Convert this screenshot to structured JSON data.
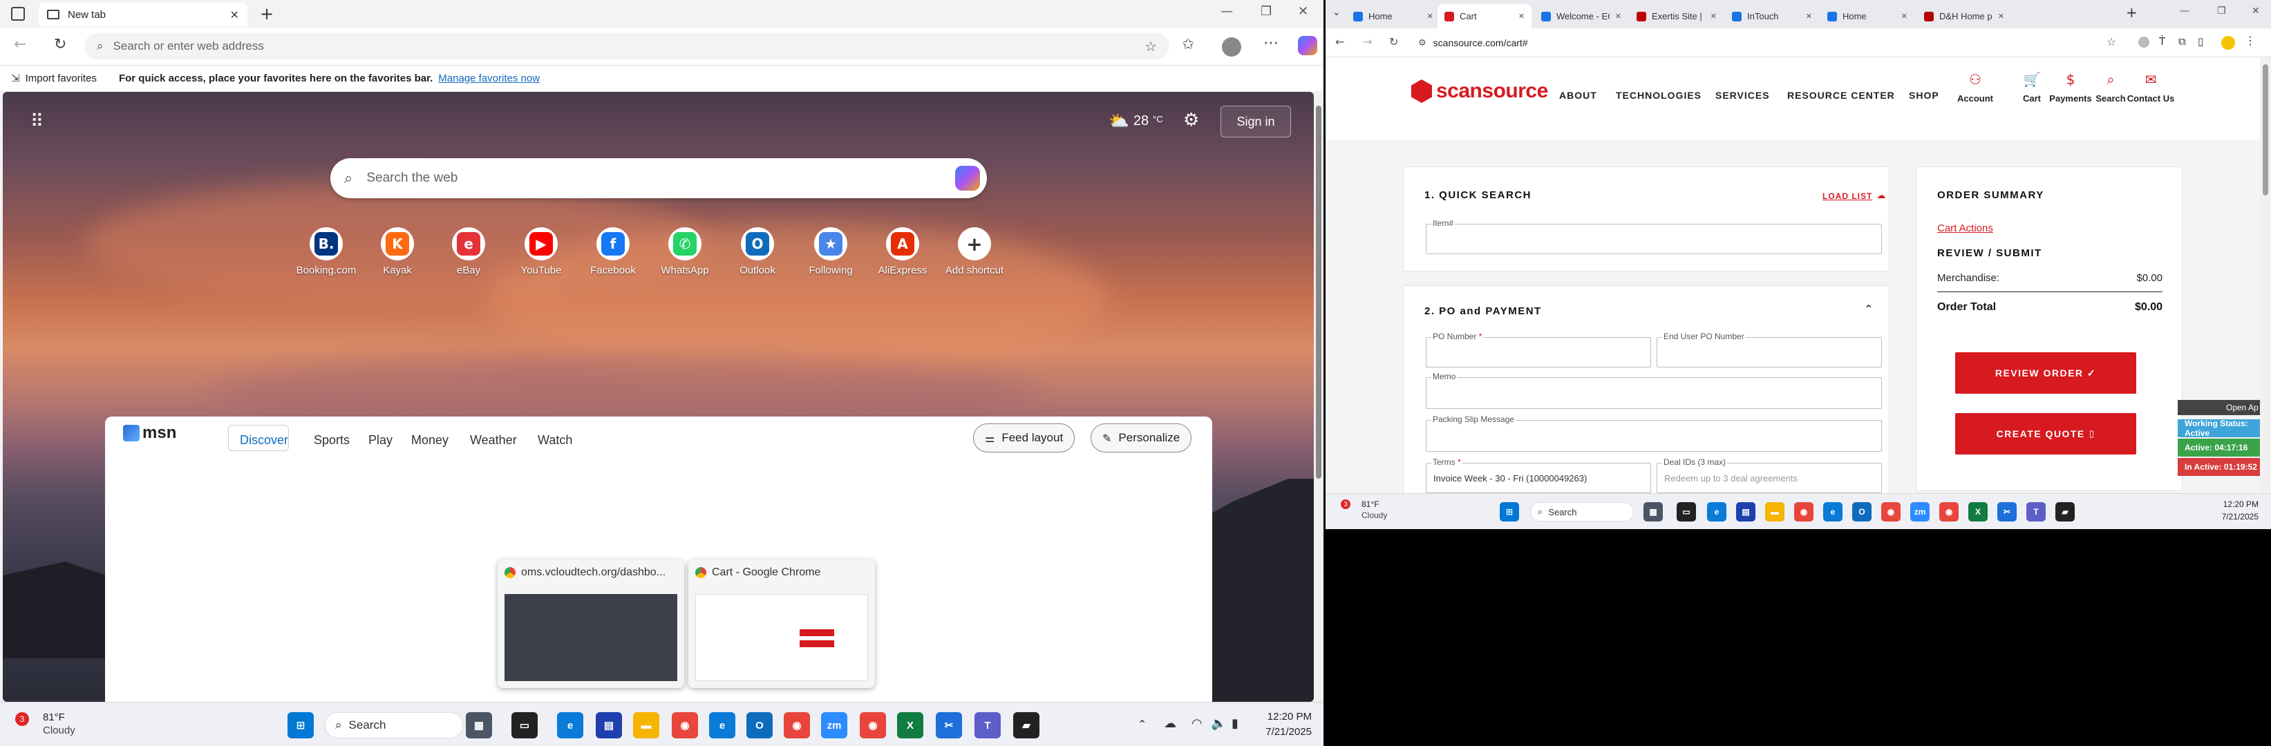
{
  "left_browser": {
    "tab_title": "New tab",
    "address_placeholder": "Search or enter web address",
    "favbar": {
      "import": "Import favorites",
      "message": "For quick access, place your favorites here on the favorites bar.",
      "manage_link": "Manage favorites now"
    },
    "newtab": {
      "weather_temp": "28",
      "weather_unit": "°C",
      "signin": "Sign in",
      "search_placeholder": "Search the web",
      "shortcuts": [
        {
          "label": "Booking.com",
          "glyph": "B.",
          "color": "#003580"
        },
        {
          "label": "Kayak",
          "glyph": "K",
          "color": "#ff690f"
        },
        {
          "label": "eBay",
          "glyph": "e",
          "color": "#e53238"
        },
        {
          "label": "YouTube",
          "glyph": "▶",
          "color": "#ff0000"
        },
        {
          "label": "Facebook",
          "glyph": "f",
          "color": "#1877f2"
        },
        {
          "label": "WhatsApp",
          "glyph": "✆",
          "color": "#25d366"
        },
        {
          "label": "Outlook",
          "glyph": "O",
          "color": "#0f6cbd"
        },
        {
          "label": "Following",
          "glyph": "★",
          "color": "#4a86e8"
        },
        {
          "label": "AliExpress",
          "glyph": "A",
          "color": "#e62e04"
        },
        {
          "label": "Add shortcut",
          "glyph": "+",
          "color": "#ffffff"
        }
      ]
    },
    "msn": {
      "logo": "msn",
      "tabs": [
        "Discover",
        "Sports",
        "Play",
        "Money",
        "Weather",
        "Watch"
      ],
      "active_tab": "Discover",
      "feed_layout": "Feed layout",
      "personalize": "Personalize"
    },
    "thumbnails": [
      {
        "title": "oms.vcloudtech.org/dashbo..."
      },
      {
        "title": "Cart - Google Chrome"
      }
    ]
  },
  "left_taskbar": {
    "weather_badge": "3",
    "weather_temp": "81°F",
    "weather_cond": "Cloudy",
    "search_placeholder": "Search",
    "time": "12:20 PM",
    "date": "7/21/2025"
  },
  "right_browser": {
    "tabs": [
      {
        "title": "Home",
        "color": "#1a73e8"
      },
      {
        "title": "Cart",
        "color": "#d71920"
      },
      {
        "title": "Welcome - ECExp",
        "color": "#1a73e8"
      },
      {
        "title": "Exertis Site | Ho",
        "color": "#c00000"
      },
      {
        "title": "InTouch",
        "color": "#1a73e8"
      },
      {
        "title": "Home",
        "color": "#1a73e8"
      },
      {
        "title": "D&H Home page",
        "color": "#b30000"
      }
    ],
    "url": "scansource.com/cart#",
    "site": {
      "logo": "scansource",
      "nav": [
        "ABOUT",
        "TECHNOLOGIES",
        "SERVICES",
        "RESOURCE CENTER",
        "SHOP"
      ],
      "utility": [
        "Account",
        "Cart",
        "Payments",
        "Search",
        "Contact Us"
      ],
      "quick_search": {
        "title": "1. QUICK SEARCH",
        "load_list": "LOAD LIST",
        "item_label": "Item#"
      },
      "po_payment": {
        "title": "2. PO and PAYMENT",
        "po_number": "PO Number",
        "end_user_po": "End User PO Number",
        "memo": "Memo",
        "packing_slip": "Packing Slip Message",
        "terms_label": "Terms",
        "terms_value": "Invoice Week - 30 - Fri (10000049263)",
        "deal_ids_label": "Deal IDs (3 max)",
        "deal_ids_placeholder": "Redeem up to 3 deal agreements"
      },
      "order_summary": {
        "title": "ORDER SUMMARY",
        "cart_actions": "Cart Actions",
        "review_submit": "REVIEW / SUBMIT",
        "merch_label": "Merchandise:",
        "merch_value": "$0.00",
        "total_label": "Order Total",
        "total_value": "$0.00",
        "review_button": "REVIEW ORDER ✓",
        "quote_button": "CREATE QUOTE"
      }
    },
    "work_widget": {
      "open": "Open Ap",
      "status": "Working Status: Active",
      "active": "Active: 04:17:16",
      "inactive": "In Active: 01:19:52"
    }
  },
  "right_taskbar": {
    "weather_badge": "3",
    "weather_temp": "81°F",
    "weather_cond": "Cloudy",
    "search_placeholder": "Search",
    "time": "12:20 PM",
    "date": "7/21/2025"
  }
}
